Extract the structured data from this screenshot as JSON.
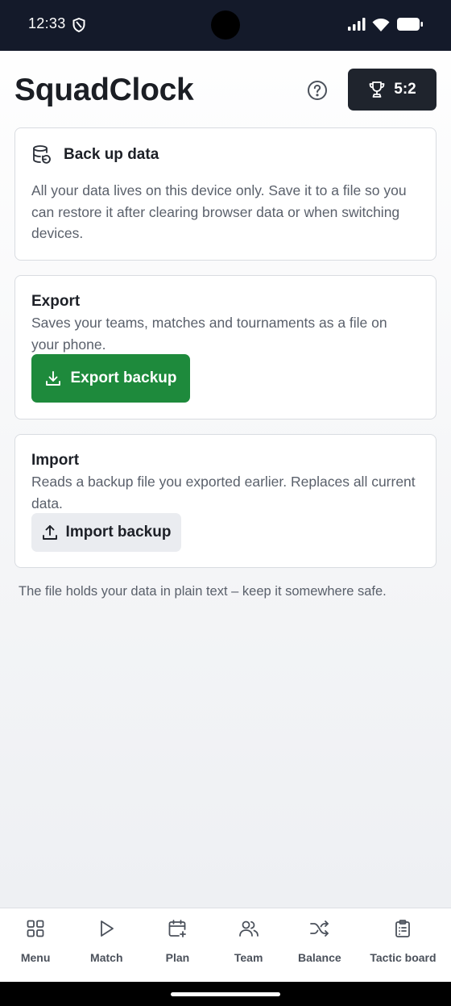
{
  "status_bar": {
    "time": "12:33"
  },
  "header": {
    "title": "SquadClock",
    "score": "5:2"
  },
  "info_card": {
    "title": "Back up data",
    "text": "All your data lives on this device only. Save it to a file so you can restore it after clearing browser data or when switching devices."
  },
  "export_card": {
    "title": "Export",
    "text": "Saves your teams, matches and tournaments as a file on your phone.",
    "button_label": "Export backup"
  },
  "import_card": {
    "title": "Import",
    "text": "Reads a backup file you exported earlier. Replaces all current data.",
    "button_label": "Import backup"
  },
  "footnote": "The file holds your data in plain text – keep it somewhere safe.",
  "bottom_nav": {
    "items": [
      {
        "label": "Menu",
        "icon": "grid-icon"
      },
      {
        "label": "Match",
        "icon": "play-icon"
      },
      {
        "label": "Plan",
        "icon": "calendar-plus-icon"
      },
      {
        "label": "Team",
        "icon": "users-icon"
      },
      {
        "label": "Balance",
        "icon": "shuffle-icon"
      },
      {
        "label": "Tactic board",
        "icon": "clipboard-icon"
      }
    ]
  },
  "colors": {
    "status_bar": "#141a2a",
    "primary_green": "#1e8a3c",
    "dark_button": "#1f242d"
  }
}
